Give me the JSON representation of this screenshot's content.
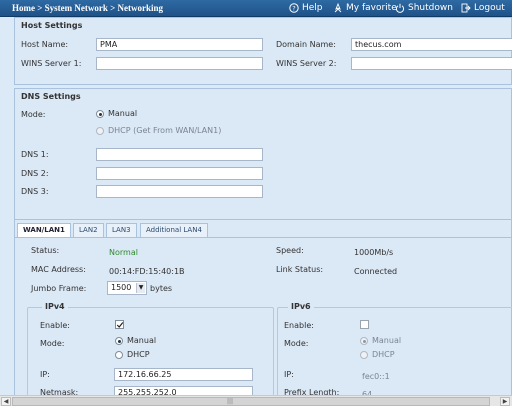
{
  "breadcrumb": {
    "home": "Home",
    "sep": ">",
    "section": "System Network",
    "page": "Networking"
  },
  "toolbar": {
    "help": "Help",
    "favorite": "My favorite",
    "shutdown": "Shutdown",
    "logout": "Logout"
  },
  "host_settings": {
    "title": "Host Settings",
    "host_name_label": "Host Name:",
    "host_name_value": "PMA",
    "domain_name_label": "Domain Name:",
    "domain_name_value": "thecus.com",
    "wins1_label": "WINS Server 1:",
    "wins1_value": "",
    "wins2_label": "WINS Server 2:",
    "wins2_value": ""
  },
  "dns_settings": {
    "title": "DNS Settings",
    "mode_label": "Mode:",
    "manual_label": "Manual",
    "dhcp_label": "DHCP (Get From WAN/LAN1)",
    "mode_selected": "manual",
    "dns1_label": "DNS 1:",
    "dns1_value": "",
    "dns2_label": "DNS 2:",
    "dns2_value": "",
    "dns3_label": "DNS 3:",
    "dns3_value": ""
  },
  "tabs": [
    "WAN/LAN1",
    "LAN2",
    "LAN3",
    "Additional LAN4"
  ],
  "active_tab": "WAN/LAN1",
  "lan": {
    "status_label": "Status:",
    "status_value": "Normal",
    "speed_label": "Speed:",
    "speed_value": "1000Mb/s",
    "mac_label": "MAC Address:",
    "mac_value": "00:14:FD:15:40:1B",
    "link_label": "Link Status:",
    "link_value": "Connected",
    "jumbo_label": "Jumbo Frame:",
    "jumbo_value": "1500",
    "jumbo_unit": "bytes"
  },
  "ipv4": {
    "legend": "IPv4",
    "enable_label": "Enable:",
    "enabled": true,
    "mode_label": "Mode:",
    "manual_label": "Manual",
    "dhcp_label": "DHCP",
    "mode_selected": "manual",
    "ip_label": "IP:",
    "ip_value": "172.16.66.25",
    "netmask_label": "Netmask:",
    "netmask_value": "255.255.252.0"
  },
  "ipv6": {
    "legend": "IPv6",
    "enable_label": "Enable:",
    "enabled": false,
    "mode_label": "Mode:",
    "manual_label": "Manual",
    "dhcp_label": "DHCP",
    "mode_selected": "manual",
    "ip_label": "IP:",
    "ip_value": "fec0::1",
    "prefix_label": "Prefix Length:",
    "prefix_value": "64"
  },
  "colors": {
    "topbar": "#1f5288",
    "status_ok": "#2e8b2e",
    "panel_bg": "#dbe8f6"
  }
}
